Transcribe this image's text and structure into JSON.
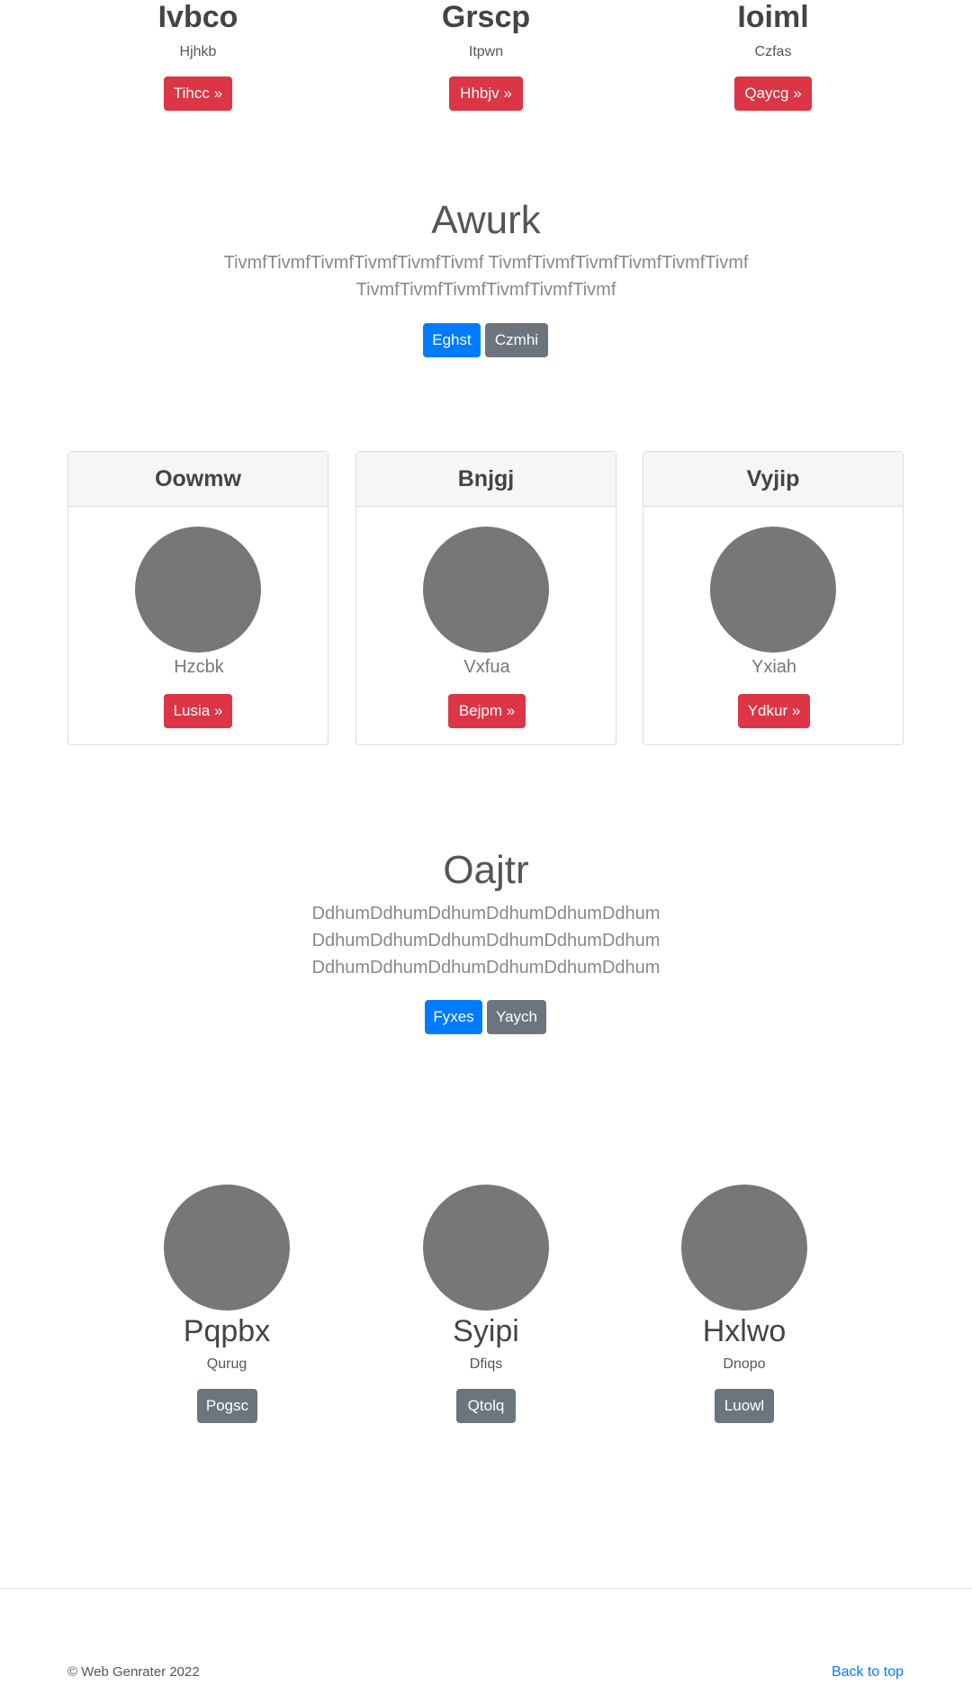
{
  "top_columns": [
    {
      "title": "Ivbco",
      "subtitle": "Hjhkb",
      "button": "Tihcc »"
    },
    {
      "title": "Grscp",
      "subtitle": "Itpwn",
      "button": "Hhbjv »"
    },
    {
      "title": "Ioiml",
      "subtitle": "Czfas",
      "button": "Qaycg »"
    }
  ],
  "section_one": {
    "heading": "Awurk",
    "paragraph_lines": [
      "TivmfTivmfTivmfTivmfTivmfTivmf TivmfTivmfTivmfTivmfTivmfTivmf",
      "TivmfTivmfTivmfTivmfTivmfTivmf"
    ],
    "primary_button": "Eghst",
    "secondary_button": "Czmhi"
  },
  "cards": [
    {
      "header": "Oowmw",
      "caption": "Hzcbk",
      "button": "Lusia »"
    },
    {
      "header": "Bnjgj",
      "caption": "Vxfua",
      "button": "Bejpm »"
    },
    {
      "header": "Vyjip",
      "caption": "Yxiah",
      "button": "Ydkur »"
    }
  ],
  "section_two": {
    "heading": "Oajtr",
    "paragraph_lines": [
      "DdhumDdhumDdhumDdhumDdhumDdhum",
      "DdhumDdhumDdhumDdhumDdhumDdhum",
      "DdhumDdhumDdhumDdhumDdhumDdhum"
    ],
    "primary_button": "Fyxes",
    "secondary_button": "Yaych"
  },
  "team": [
    {
      "name": "Pqpbx",
      "subtitle": "Qurug",
      "button": "Pogsc"
    },
    {
      "name": "Syipi",
      "subtitle": "Dfiqs",
      "button": "Qtolq"
    },
    {
      "name": "Hxlwo",
      "subtitle": "Dnopo",
      "button": "Luowl"
    }
  ],
  "footer": {
    "copyright": "© Web Genrater 2022",
    "back_to_top": "Back to top"
  },
  "colors": {
    "danger": "#dc3545",
    "primary": "#007bff",
    "secondary": "#6c757d",
    "placeholder": "#777777"
  }
}
